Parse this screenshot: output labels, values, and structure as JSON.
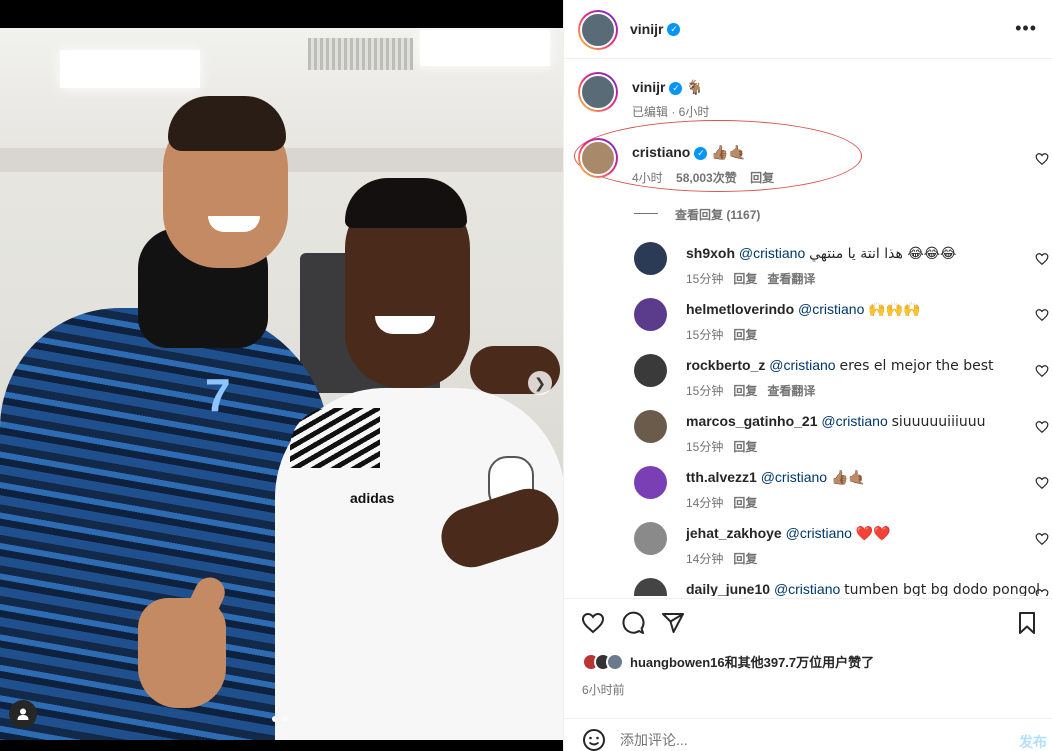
{
  "post": {
    "author": "vinijr",
    "caption_emoji": "🐐",
    "caption_meta": "已编辑 · 6小时",
    "more_label": "•••"
  },
  "highlight_comment": {
    "user": "cristiano",
    "text": "👍🏽🤙🏽",
    "time": "4小时",
    "likes": "58,003次赞",
    "reply": "回复",
    "view_replies": "查看回复 (1167)"
  },
  "replies": [
    {
      "user": "sh9xoh",
      "mention": "@cristiano",
      "text": "هذا انتة يا منتهي 😂😂😂",
      "time": "15分钟",
      "reply": "回复",
      "translate": "查看翻译",
      "color": "#2b3a55"
    },
    {
      "user": "helmetloverindo",
      "mention": "@cristiano",
      "text": "🙌🙌🙌",
      "time": "15分钟",
      "reply": "回复",
      "translate": "",
      "color": "#5b3b8c"
    },
    {
      "user": "rockberto_z",
      "mention": "@cristiano",
      "text": "eres el mejor the best",
      "time": "15分钟",
      "reply": "回复",
      "translate": "查看翻译",
      "color": "#3a3a3a"
    },
    {
      "user": "marcos_gatinho_21",
      "mention": "@cristiano",
      "text": "siuuuuuiiiuuu",
      "time": "15分钟",
      "reply": "回复",
      "translate": "",
      "color": "#6b5b4b"
    },
    {
      "user": "tth.alvezz1",
      "mention": "@cristiano",
      "text": "👍🏽🤙🏽",
      "time": "14分钟",
      "reply": "回复",
      "translate": "",
      "color": "#7a3fb5"
    },
    {
      "user": "jehat_zakhoye",
      "mention": "@cristiano",
      "text": "❤️❤️",
      "time": "14分钟",
      "reply": "回复",
      "translate": "",
      "color": "#8a8a8a"
    },
    {
      "user": "daily_june10",
      "mention": "@cristiano",
      "text": "tumben bgt bg dodo pongol",
      "time": "",
      "reply": "",
      "translate": "",
      "color": "#444444"
    }
  ],
  "photo": {
    "jersey_number": "7",
    "brand": "adidas"
  },
  "likes_summary": "huangbowen16和其他397.7万位用户赞了",
  "posted_time": "6小时前",
  "comment_input": {
    "placeholder": "添加评论...",
    "publish": "发布"
  },
  "icons": {
    "like": "heart-icon",
    "comment": "comment-icon",
    "share": "share-icon",
    "save": "bookmark-icon",
    "emoji": "emoji-icon"
  }
}
